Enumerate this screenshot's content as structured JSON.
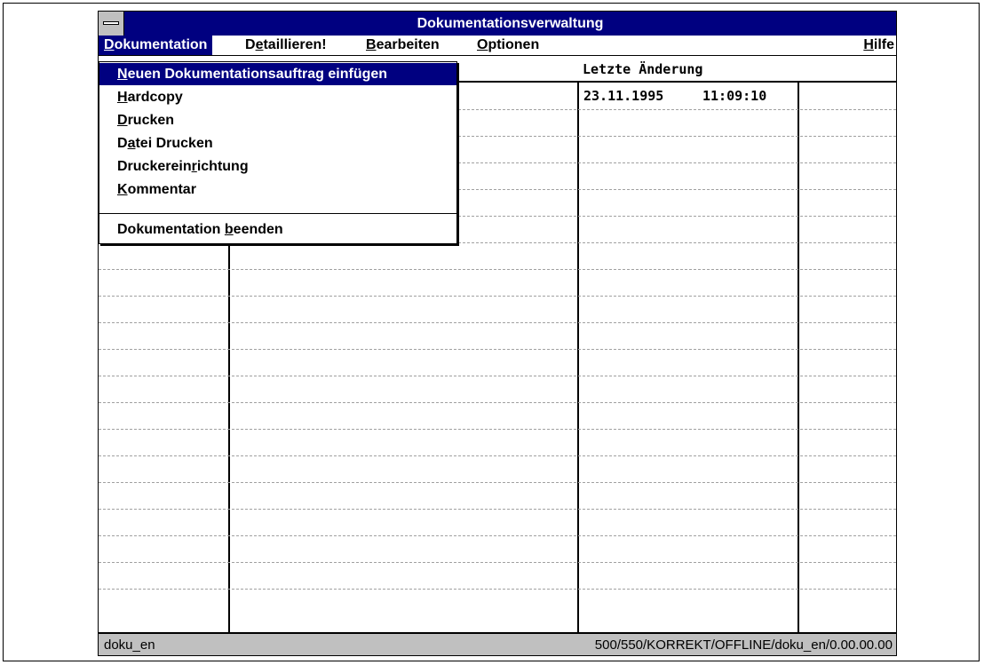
{
  "window": {
    "title": "Dokumentationsverwaltung"
  },
  "menubar": {
    "items": [
      {
        "pre": "",
        "acc": "D",
        "post": "okumentation"
      },
      {
        "pre": "D",
        "acc": "e",
        "post": "taillieren!"
      },
      {
        "pre": "",
        "acc": "B",
        "post": "earbeiten"
      },
      {
        "pre": "",
        "acc": "O",
        "post": "ptionen"
      },
      {
        "pre": "",
        "acc": "H",
        "post": "ilfe"
      }
    ]
  },
  "dropdown": {
    "items": [
      {
        "pre": "",
        "acc": "N",
        "post": "euen Dokumentationsauftrag einfügen"
      },
      {
        "pre": "",
        "acc": "H",
        "post": "ardcopy"
      },
      {
        "pre": "",
        "acc": "D",
        "post": "rucken"
      },
      {
        "pre": "D",
        "acc": "a",
        "post": "tei Drucken"
      },
      {
        "pre": "Druckerein",
        "acc": "r",
        "post": "ichtung"
      },
      {
        "pre": "",
        "acc": "K",
        "post": "ommentar"
      },
      {
        "pre": "Dokumentation ",
        "acc": "b",
        "post": "eenden"
      }
    ]
  },
  "table": {
    "header_last_change": "Letzte Änderung",
    "row1_date": "23.11.1995",
    "row1_time": "11:09:10"
  },
  "statusbar": {
    "left": "doku_en",
    "right": "500/550/KORREKT/OFFLINE/doku_en/0.00.00.00"
  }
}
